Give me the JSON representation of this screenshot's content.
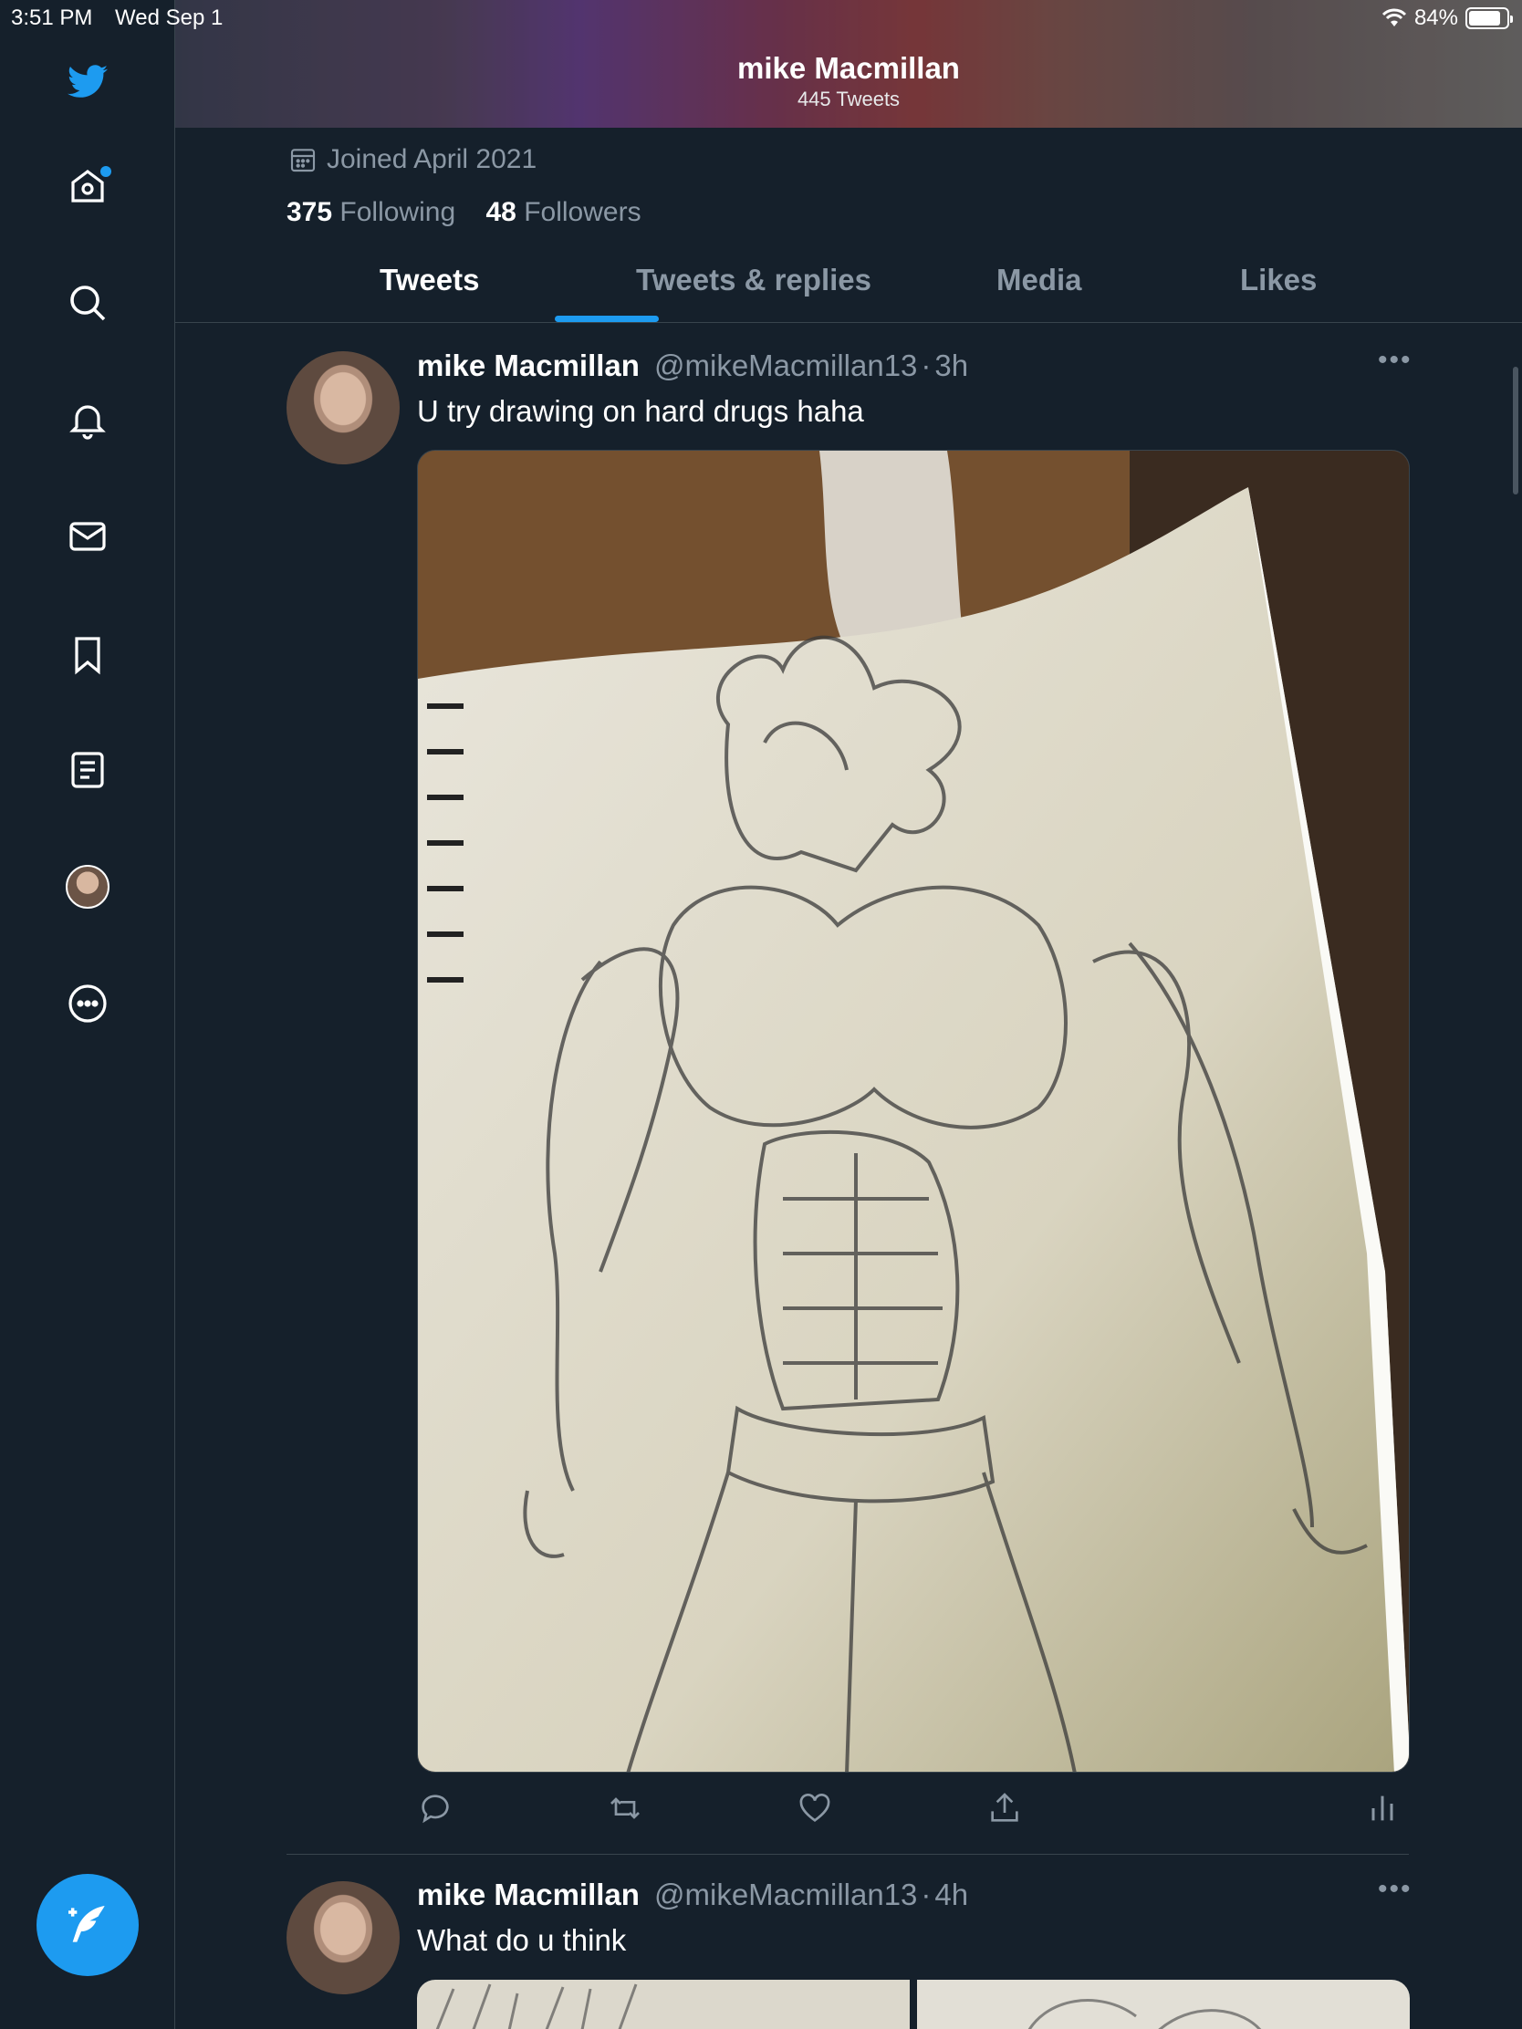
{
  "status_bar": {
    "time": "3:51 PM",
    "date": "Wed Sep 1",
    "battery": "84%",
    "battery_level": 0.84
  },
  "sidebar": {
    "items": [
      "twitter-logo",
      "home-icon",
      "search-icon",
      "bell-icon",
      "mail-icon",
      "bookmark-icon",
      "lists-icon",
      "profile-avatar",
      "more-icon"
    ]
  },
  "header": {
    "title": "mike Macmillan",
    "subtitle": "445 Tweets"
  },
  "profile": {
    "joined": "Joined April 2021",
    "following_count": "375",
    "following_label": "Following",
    "followers_count": "48",
    "followers_label": "Followers"
  },
  "tabs": [
    {
      "label": "Tweets",
      "active": true
    },
    {
      "label": "Tweets & replies",
      "active": false
    },
    {
      "label": "Media",
      "active": false
    },
    {
      "label": "Likes",
      "active": false
    }
  ],
  "tweets": [
    {
      "name": "mike Macmillan",
      "handle": "@mikeMacmillan13",
      "sep": "·",
      "time": "3h",
      "text": "U try drawing on hard drugs haha"
    },
    {
      "name": "mike Macmillan",
      "handle": "@mikeMacmillan13",
      "sep": "·",
      "time": "4h",
      "text": "What do u think"
    }
  ],
  "colors": {
    "background": "#15202b",
    "accent": "#1d9bf0",
    "secondary_text": "#8b98a5",
    "border": "#38444d"
  }
}
